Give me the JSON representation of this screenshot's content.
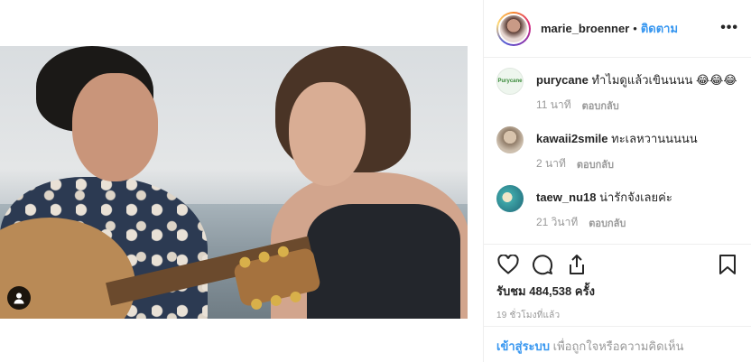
{
  "post": {
    "owner_username": "marie_broenner",
    "separator": "•",
    "follow_label": "ติดตาม",
    "more_label": "•••"
  },
  "comments": [
    {
      "username": "purycane",
      "text": "ทำไมดูแล้วเขินนนน 😂😂😂",
      "time": "11 นาที",
      "reply_label": "ตอบกลับ",
      "avatar_label": "Purycane",
      "avatar_color": "#eef6ee"
    },
    {
      "username": "kawaii2smile",
      "text": "ทะเลหวานนนนน",
      "time": "2 นาที",
      "reply_label": "ตอบกลับ",
      "avatar_color": "#b8a58f"
    },
    {
      "username": "taew_nu18",
      "text": "น่ารักจังเลยค่ะ",
      "time": "21 วินาที",
      "reply_label": "ตอบกลับ",
      "avatar_color": "#3fa7a9"
    }
  ],
  "stats": {
    "views_label": "รับชม",
    "views_count": "484,538",
    "views_unit": "ครั้ง",
    "posted_ago": "19 ชั่วโมงที่แล้ว"
  },
  "login_prompt": {
    "login_link": "เข้าสู่ระบบ",
    "rest": "เพื่อถูกใจหรือความคิดเห็น"
  },
  "colors": {
    "accent": "#3897f0",
    "text": "#262626",
    "muted": "#999999",
    "border": "#efefef"
  },
  "icons": [
    "more-options-icon",
    "heart-icon",
    "comment-icon",
    "share-icon",
    "bookmark-icon",
    "user-tag-icon"
  ]
}
